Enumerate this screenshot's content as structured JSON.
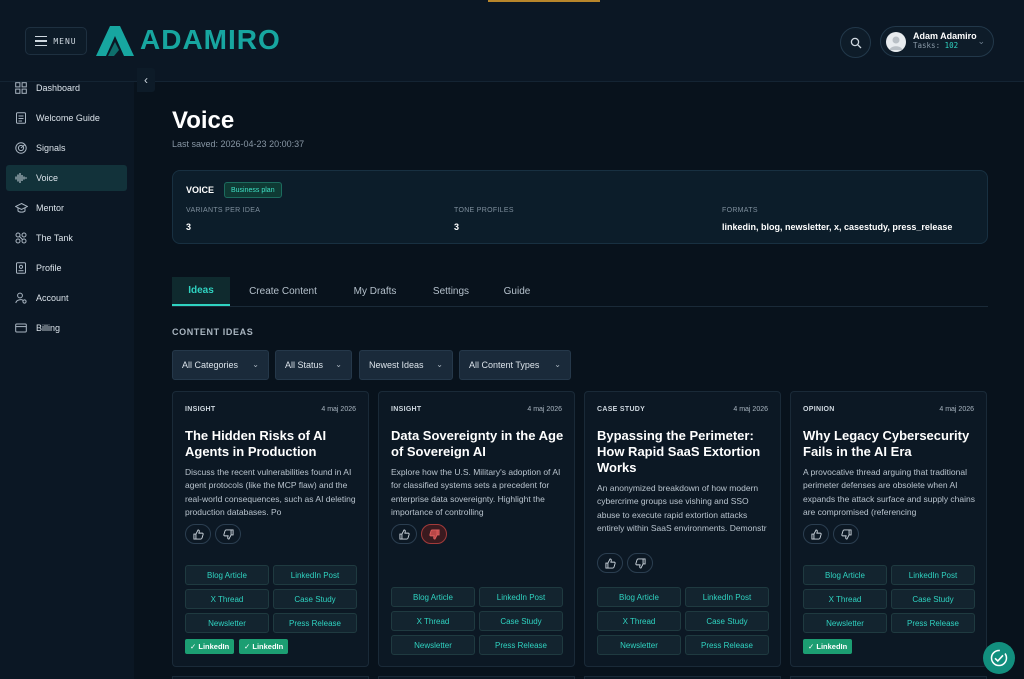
{
  "header": {
    "menu_label": "MENU",
    "logo_text": "ADAMIRO",
    "user": {
      "name": "Adam Adamiro",
      "tasks_label": "Tasks:",
      "tasks_count": "102"
    }
  },
  "sidebar": {
    "items": [
      {
        "label": "Dashboard",
        "icon": "grid-icon"
      },
      {
        "label": "Welcome Guide",
        "icon": "document-icon"
      },
      {
        "label": "Signals",
        "icon": "radar-icon"
      },
      {
        "label": "Voice",
        "icon": "waveform-icon",
        "active": true
      },
      {
        "label": "Mentor",
        "icon": "graduation-cap-icon"
      },
      {
        "label": "The Tank",
        "icon": "network-icon"
      },
      {
        "label": "Profile",
        "icon": "profile-icon"
      },
      {
        "label": "Account",
        "icon": "user-gear-icon"
      },
      {
        "label": "Billing",
        "icon": "credit-card-icon"
      }
    ]
  },
  "page": {
    "title": "Voice",
    "last_saved": "Last saved: 2026-04-23 20:00:37"
  },
  "plan": {
    "title": "VOICE",
    "badge": "Business plan",
    "stats": [
      {
        "label": "VARIANTS PER IDEA",
        "value": "3"
      },
      {
        "label": "TONE PROFILES",
        "value": "3"
      },
      {
        "label": "FORMATS",
        "value": "linkedin, blog, newsletter, x, casestudy, press_release"
      }
    ]
  },
  "tabs": [
    "Ideas",
    "Create Content",
    "My Drafts",
    "Settings",
    "Guide"
  ],
  "section_heading": "CONTENT IDEAS",
  "filters": [
    "All Categories",
    "All Status",
    "Newest Ideas",
    "All Content Types"
  ],
  "cards": [
    {
      "category": "INSIGHT",
      "date": "4 maj 2026",
      "title": "The Hidden Risks of AI Agents in Production",
      "desc": "Discuss the recent vulnerabilities found in AI agent protocols (like the MCP flaw) and the real-world consequences, such as AI deleting production databases. Po",
      "formats": [
        "Blog Article",
        "LinkedIn Post",
        "X Thread",
        "Case Study",
        "Newsletter",
        "Press Release"
      ],
      "done": [
        "✓ LinkedIn",
        "✓ LinkedIn"
      ]
    },
    {
      "category": "INSIGHT",
      "date": "4 maj 2026",
      "title": "Data Sovereignty in the Age of Sovereign AI",
      "desc": "Explore how the U.S. Military's adoption of AI for classified systems sets a precedent for enterprise data sovereignty. Highlight the importance of controlling",
      "formats": [
        "Blog Article",
        "LinkedIn Post",
        "X Thread",
        "Case Study",
        "Newsletter",
        "Press Release"
      ],
      "done": []
    },
    {
      "category": "CASE STUDY",
      "date": "4 maj 2026",
      "title": "Bypassing the Perimeter: How Rapid SaaS Extortion Works",
      "desc": "An anonymized breakdown of how modern cybercrime groups use vishing and SSO abuse to execute rapid extortion attacks entirely within SaaS environments. Demonstr",
      "formats": [
        "Blog Article",
        "LinkedIn Post",
        "X Thread",
        "Case Study",
        "Newsletter",
        "Press Release"
      ],
      "done": []
    },
    {
      "category": "OPINION",
      "date": "4 maj 2026",
      "title": "Why Legacy Cybersecurity Fails in the AI Era",
      "desc": "A provocative thread arguing that traditional perimeter defenses are obsolete when AI expands the attack surface and supply chains are compromised (referencing",
      "formats": [
        "Blog Article",
        "LinkedIn Post",
        "X Thread",
        "Case Study",
        "Newsletter",
        "Press Release"
      ],
      "done": [
        "✓ LinkedIn"
      ]
    }
  ]
}
